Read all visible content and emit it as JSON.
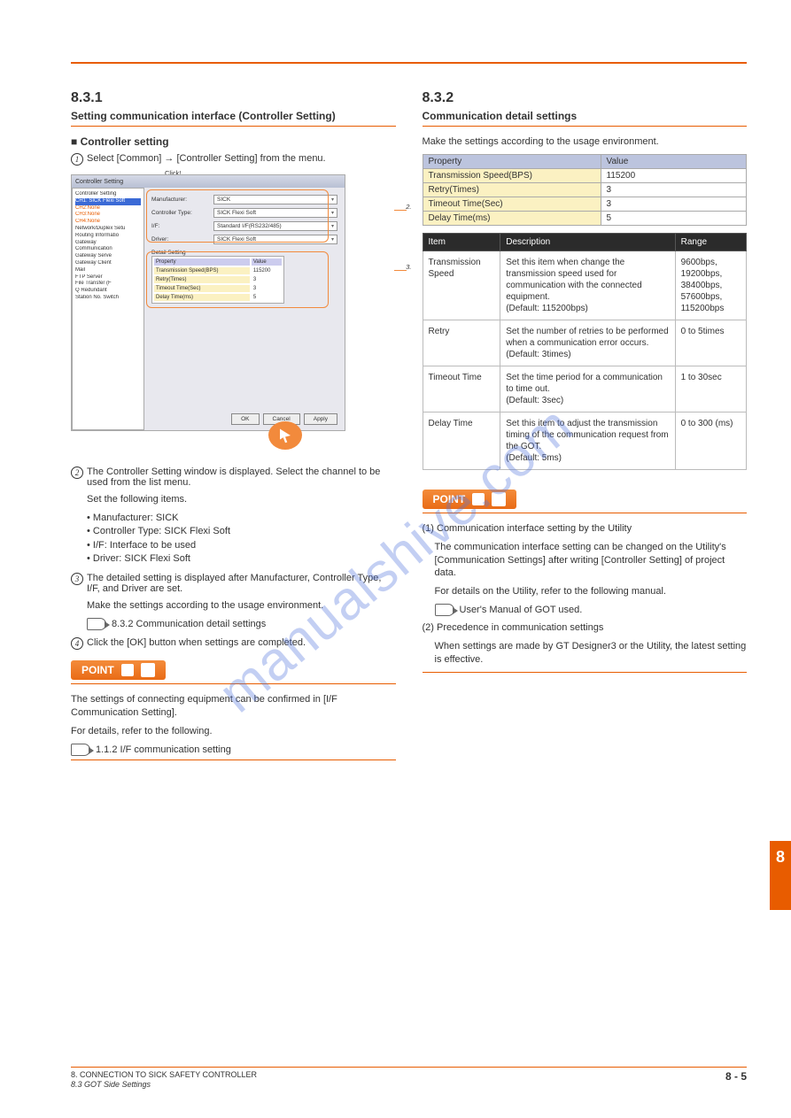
{
  "section": {
    "num_left": "8.3.1",
    "title_left": "Setting communication interface (Controller Setting)",
    "step1": "Select [Common] → [Controller Setting] from the menu."
  },
  "screenshot": {
    "window_title": "Controller Setting",
    "tree": [
      {
        "t": "Controller Setting",
        "sel": false
      },
      {
        "t": "CH1: SICK Flexi Soft",
        "sel": true
      },
      {
        "t": "CH2:None",
        "sel": false
      },
      {
        "t": "CH3:None",
        "sel": false
      },
      {
        "t": "CH4:None",
        "sel": false
      },
      {
        "t": "Network/Duplex Setu",
        "sel": false
      },
      {
        "t": "Routing Informatio",
        "sel": false
      },
      {
        "t": "Gateway",
        "sel": false
      },
      {
        "t": "Communication",
        "sel": false
      },
      {
        "t": "Gateway Serve",
        "sel": false
      },
      {
        "t": "Gateway Client",
        "sel": false
      },
      {
        "t": "Mail",
        "sel": false
      },
      {
        "t": "FTP Server",
        "sel": false
      },
      {
        "t": "File Transfer (F",
        "sel": false
      },
      {
        "t": "Q Redundant",
        "sel": false
      },
      {
        "t": "Station No. Switch",
        "sel": false
      }
    ],
    "fields": {
      "manufacturer_lbl": "Manufacturer:",
      "manufacturer_val": "SICK",
      "controller_lbl": "Controller Type:",
      "controller_val": "SICK Flexi Soft",
      "if_lbl": "I/F:",
      "if_val": "Standard I/F(RS232/485)",
      "driver_lbl": "Driver:",
      "driver_val": "SICK Flexi Soft",
      "detail_head": "Detail Setting",
      "prop_head": "Property",
      "val_head": "Value",
      "rows": [
        {
          "k": "Transmission Speed(BPS)",
          "v": "115200"
        },
        {
          "k": "Retry(Times)",
          "v": "3"
        },
        {
          "k": "Timeout Time(Sec)",
          "v": "3"
        },
        {
          "k": "Delay Time(ms)",
          "v": "5"
        }
      ]
    },
    "buttons": {
      "ok": "OK",
      "cancel": "Cancel",
      "apply": "Apply"
    },
    "callouts": {
      "red1": "Click!",
      "c2": "2.",
      "c3": "3."
    }
  },
  "steps": {
    "s2a": "The Controller Setting window is displayed. Select the channel to be used from the list menu.",
    "s2b": "Set the following items.",
    "bullets": [
      "Manufacturer: SICK",
      "Controller Type: SICK Flexi Soft",
      "I/F: Interface to be used",
      "Driver: SICK Flexi Soft"
    ],
    "s3": "The detailed setting is displayed after Manufacturer, Controller Type, I/F, and Driver are set.",
    "s3b": "Make the settings according to the usage environment.",
    "s3link": "8.3.2 Communication detail settings",
    "s4": "Click the [OK] button when settings are completed."
  },
  "point1": {
    "label": "POINT",
    "body": "The settings of connecting equipment can be confirmed in [I/F Communication Setting].",
    "body2": "For details, refer to the following.",
    "link": "1.1.2 I/F communication setting"
  },
  "right": {
    "sec_num": "8.3.2",
    "sec_title": "Communication detail settings",
    "sub": "Make the settings according to the usage environment.",
    "detail_tbl": {
      "h1": "Property",
      "h2": "Value",
      "rows": [
        {
          "k": "Transmission Speed(BPS)",
          "v": "115200"
        },
        {
          "k": "Retry(Times)",
          "v": "3"
        },
        {
          "k": "Timeout Time(Sec)",
          "v": "3"
        },
        {
          "k": "Delay Time(ms)",
          "v": "5"
        }
      ]
    },
    "desc_tbl": {
      "h1": "Item",
      "h2": "Description",
      "h3": "Range",
      "rows": [
        {
          "a": "Transmission Speed",
          "b": "Set this item when change the transmission speed used for communication with the connected equipment.\n(Default: 115200bps)",
          "c": "9600bps,\n19200bps,\n38400bps,\n57600bps,\n115200bps"
        },
        {
          "a": "Retry",
          "b": "Set the number of retries to be performed when a communication error occurs.\n(Default: 3times)",
          "c": "0 to 5times"
        },
        {
          "a": "Timeout Time",
          "b": "Set the time period for a communication to time out.\n(Default: 3sec)",
          "c": "1 to 30sec"
        },
        {
          "a": "Delay Time",
          "b": "Set this item to adjust the transmission timing of the communication request from the GOT.\n(Default: 5ms)",
          "c": "0 to 300 (ms)"
        }
      ]
    }
  },
  "point2": {
    "label": "POINT",
    "p1_head": "(1) Communication interface setting by the Utility",
    "p1_body": "The communication interface setting can be changed on the Utility's [Communication Settings] after writing [Controller Setting] of project data.",
    "p1_body2": "For details on the Utility, refer to the following manual.",
    "p1_link": "User's Manual of GOT used.",
    "p2_head": "(2) Precedence in communication settings",
    "p2_body": "When settings are made by GT Designer3 or the Utility, the latest setting is effective."
  },
  "sidebar": "8",
  "footer": {
    "ref1": "8. CONNECTION TO SICK SAFETY CONTROLLER",
    "ref2": "8.3 GOT Side Settings",
    "page": "8 - 5"
  },
  "watermark": "manualshive.com"
}
